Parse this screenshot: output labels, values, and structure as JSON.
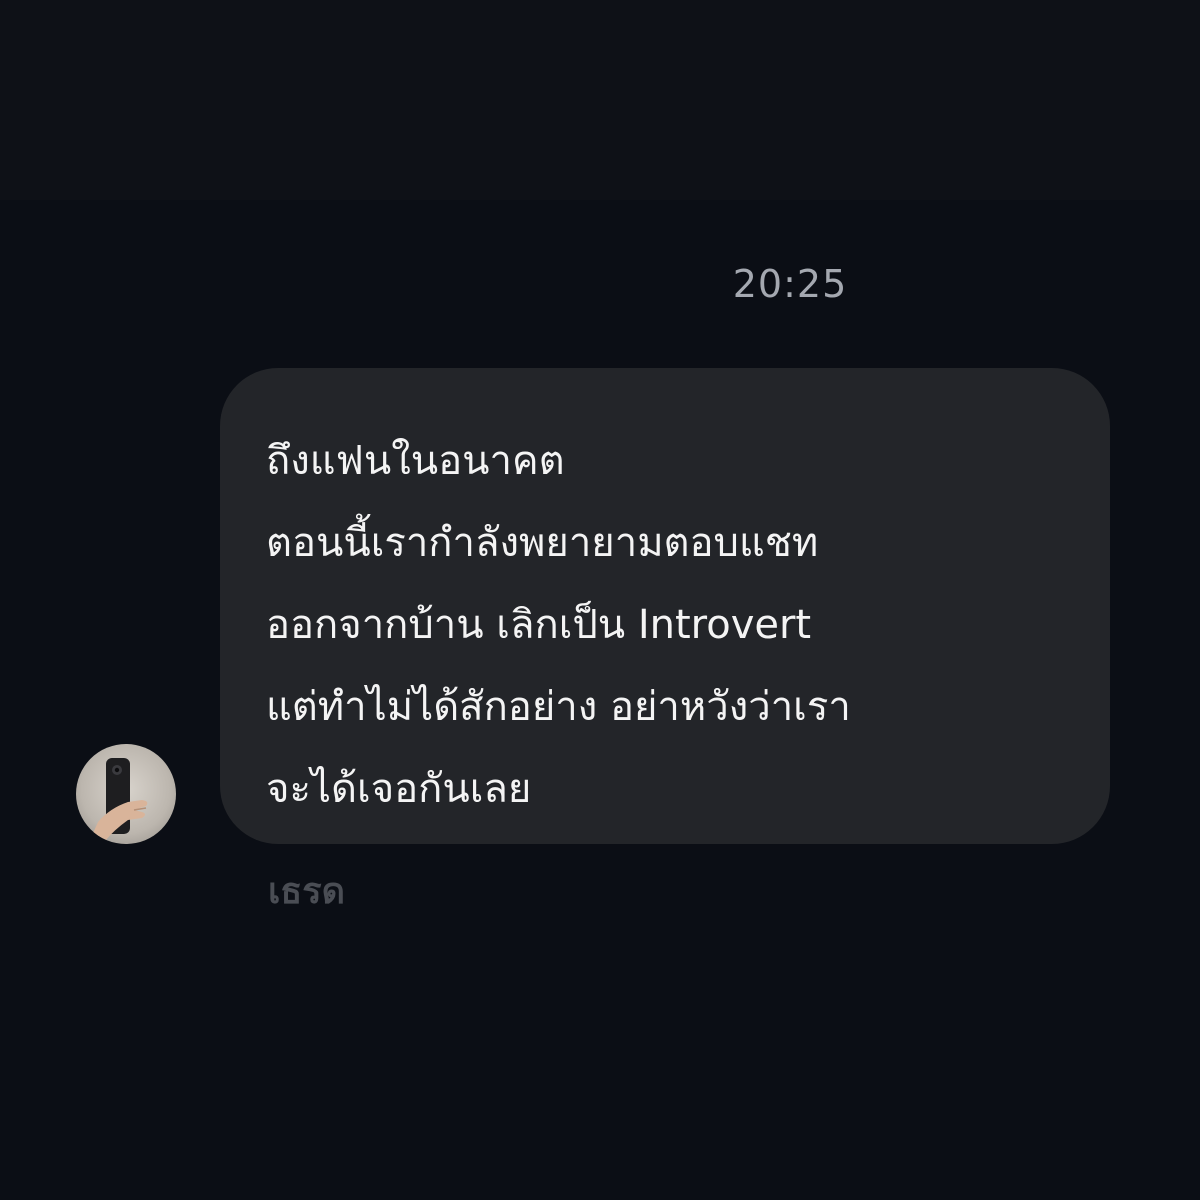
{
  "conversation": {
    "timestamp": "20:25",
    "message": {
      "lines": [
        "ถึงแฟนในอนาคต",
        "ตอนนี้เรากำลังพยายามตอบแชท",
        "ออกจากบ้าน เลิกเป็น Introvert",
        "แต่ทำไม่ได้สักอย่าง อย่าหวังว่าเรา",
        "จะได้เจอกันเลย"
      ]
    },
    "sender_label": "เธรด",
    "avatar": {
      "icon": "phone-selfie-avatar"
    }
  },
  "colors": {
    "background": "#0b0e15",
    "bubble": "#232529",
    "message_text": "#f4f4f4",
    "timestamp": "#a4a8b0",
    "sender_label": "#4a4d54"
  }
}
